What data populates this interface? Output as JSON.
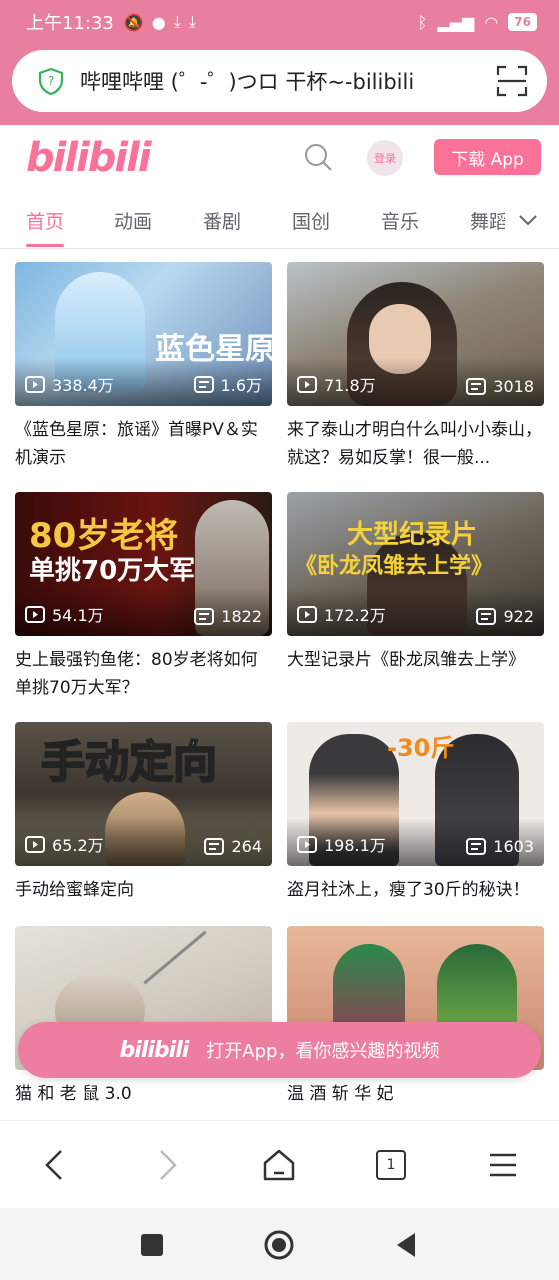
{
  "status_bar": {
    "time": "上午11:33",
    "battery": "76"
  },
  "url_bar": {
    "text": "哔哩哔哩 (゜-゜)つロ 干杯~-bilibili"
  },
  "header": {
    "logo": "bilibili",
    "login_label": "登录",
    "download_label": "下载 App"
  },
  "tabs": [
    {
      "label": "首页",
      "active": true
    },
    {
      "label": "动画"
    },
    {
      "label": "番剧"
    },
    {
      "label": "国创"
    },
    {
      "label": "音乐"
    },
    {
      "label": "舞蹈"
    }
  ],
  "videos": [
    {
      "title": "《蓝色星原：旅谣》首曝PV＆实机演示",
      "views": "338.4万",
      "danmaku": "1.6万",
      "overlay": "蓝色星原"
    },
    {
      "title": "来了泰山才明白什么叫小小泰山，就这？易如反掌！很一般...",
      "views": "71.8万",
      "danmaku": "3018",
      "overlay": ""
    },
    {
      "title": "史上最强钓鱼佬：80岁老将如何单挑70万大军？",
      "views": "54.1万",
      "danmaku": "1822",
      "overlay": "80岁老将",
      "overlay2": "单挑70万大军"
    },
    {
      "title": "大型记录片《卧龙凤雏去上学》",
      "views": "172.2万",
      "danmaku": "922",
      "overlay": "大型纪录片",
      "overlay2": "《卧龙凤雏去上学》"
    },
    {
      "title": "手动给蜜蜂定向",
      "views": "65.2万",
      "danmaku": "264",
      "overlay": "手动定向"
    },
    {
      "title": "盗月社沐上，瘦了30斤的秘诀！",
      "views": "198.1万",
      "danmaku": "1603",
      "overlay": "-30斤"
    },
    {
      "title": "猫 和 老 鼠 3.0",
      "views": "",
      "danmaku": "",
      "overlay": ""
    },
    {
      "title": "温 酒 斩 华 妃",
      "views": "",
      "danmaku": "",
      "overlay": ""
    }
  ],
  "open_app": {
    "logo": "bilibili",
    "text": "打开App，看你感兴趣的视频"
  },
  "browser_bar": {
    "tab_count": "1"
  },
  "colors": {
    "accent": "#fb7299",
    "statusbar": "#e87f9f"
  }
}
